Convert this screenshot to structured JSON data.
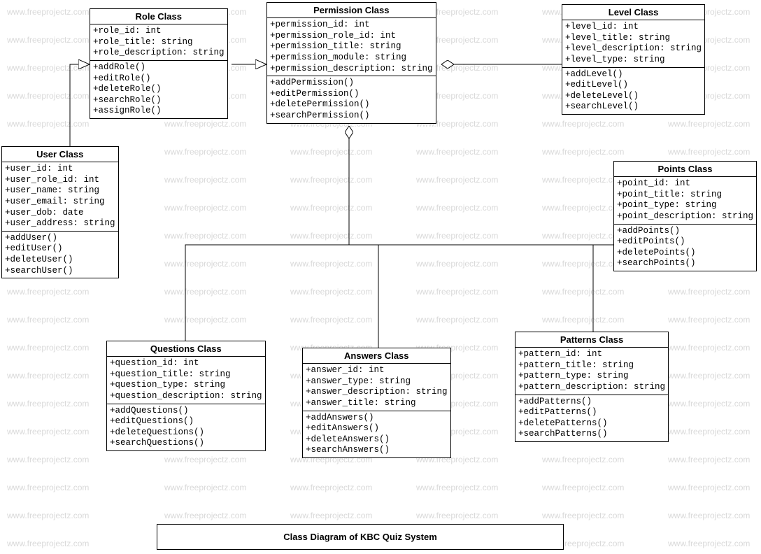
{
  "watermark": "www.freeprojectz.com",
  "caption": "Class Diagram of KBC Quiz System",
  "classes": {
    "role": {
      "title": "Role Class",
      "attrs": [
        "+role_id: int",
        "+role_title: string",
        "+role_description: string"
      ],
      "ops": [
        "+addRole()",
        "+editRole()",
        "+deleteRole()",
        "+searchRole()",
        "+assignRole()"
      ]
    },
    "permission": {
      "title": "Permission Class",
      "attrs": [
        "+permission_id: int",
        "+permission_role_id: int",
        "+permission_title: string",
        "+permission_module: string",
        "+permission_description: string"
      ],
      "ops": [
        "+addPermission()",
        "+editPermission()",
        "+deletePermission()",
        "+searchPermission()"
      ]
    },
    "level": {
      "title": "Level Class",
      "attrs": [
        "+level_id: int",
        "+level_title: string",
        "+level_description: string",
        "+level_type: string"
      ],
      "ops": [
        "+addLevel()",
        "+editLevel()",
        "+deleteLevel()",
        "+searchLevel()"
      ]
    },
    "user": {
      "title": "User Class",
      "attrs": [
        "+user_id: int",
        "+user_role_id: int",
        "+user_name: string",
        "+user_email: string",
        "+user_dob: date",
        "+user_address: string"
      ],
      "ops": [
        "+addUser()",
        "+editUser()",
        "+deleteUser()",
        "+searchUser()"
      ]
    },
    "points": {
      "title": "Points Class",
      "attrs": [
        "+point_id: int",
        "+point_title: string",
        "+point_type: string",
        "+point_description: string"
      ],
      "ops": [
        "+addPoints()",
        "+editPoints()",
        "+deletePoints()",
        "+searchPoints()"
      ]
    },
    "questions": {
      "title": "Questions Class",
      "attrs": [
        "+question_id: int",
        "+question_title: string",
        "+question_type: string",
        "+question_description: string"
      ],
      "ops": [
        "+addQuestions()",
        "+editQuestions()",
        "+deleteQuestions()",
        "+searchQuestions()"
      ]
    },
    "answers": {
      "title": "Answers Class",
      "attrs": [
        "+answer_id: int",
        "+answer_type: string",
        "+answer_description: string",
        "+answer_title: string"
      ],
      "ops": [
        "+addAnswers()",
        "+editAnswers()",
        "+deleteAnswers()",
        "+searchAnswers()"
      ]
    },
    "patterns": {
      "title": "Patterns Class",
      "attrs": [
        "+pattern_id: int",
        "+pattern_title: string",
        "+pattern_type: string",
        "+pattern_description: string"
      ],
      "ops": [
        "+addPatterns()",
        "+editPatterns()",
        "+deletePatterns()",
        "+searchPatterns()"
      ]
    }
  }
}
